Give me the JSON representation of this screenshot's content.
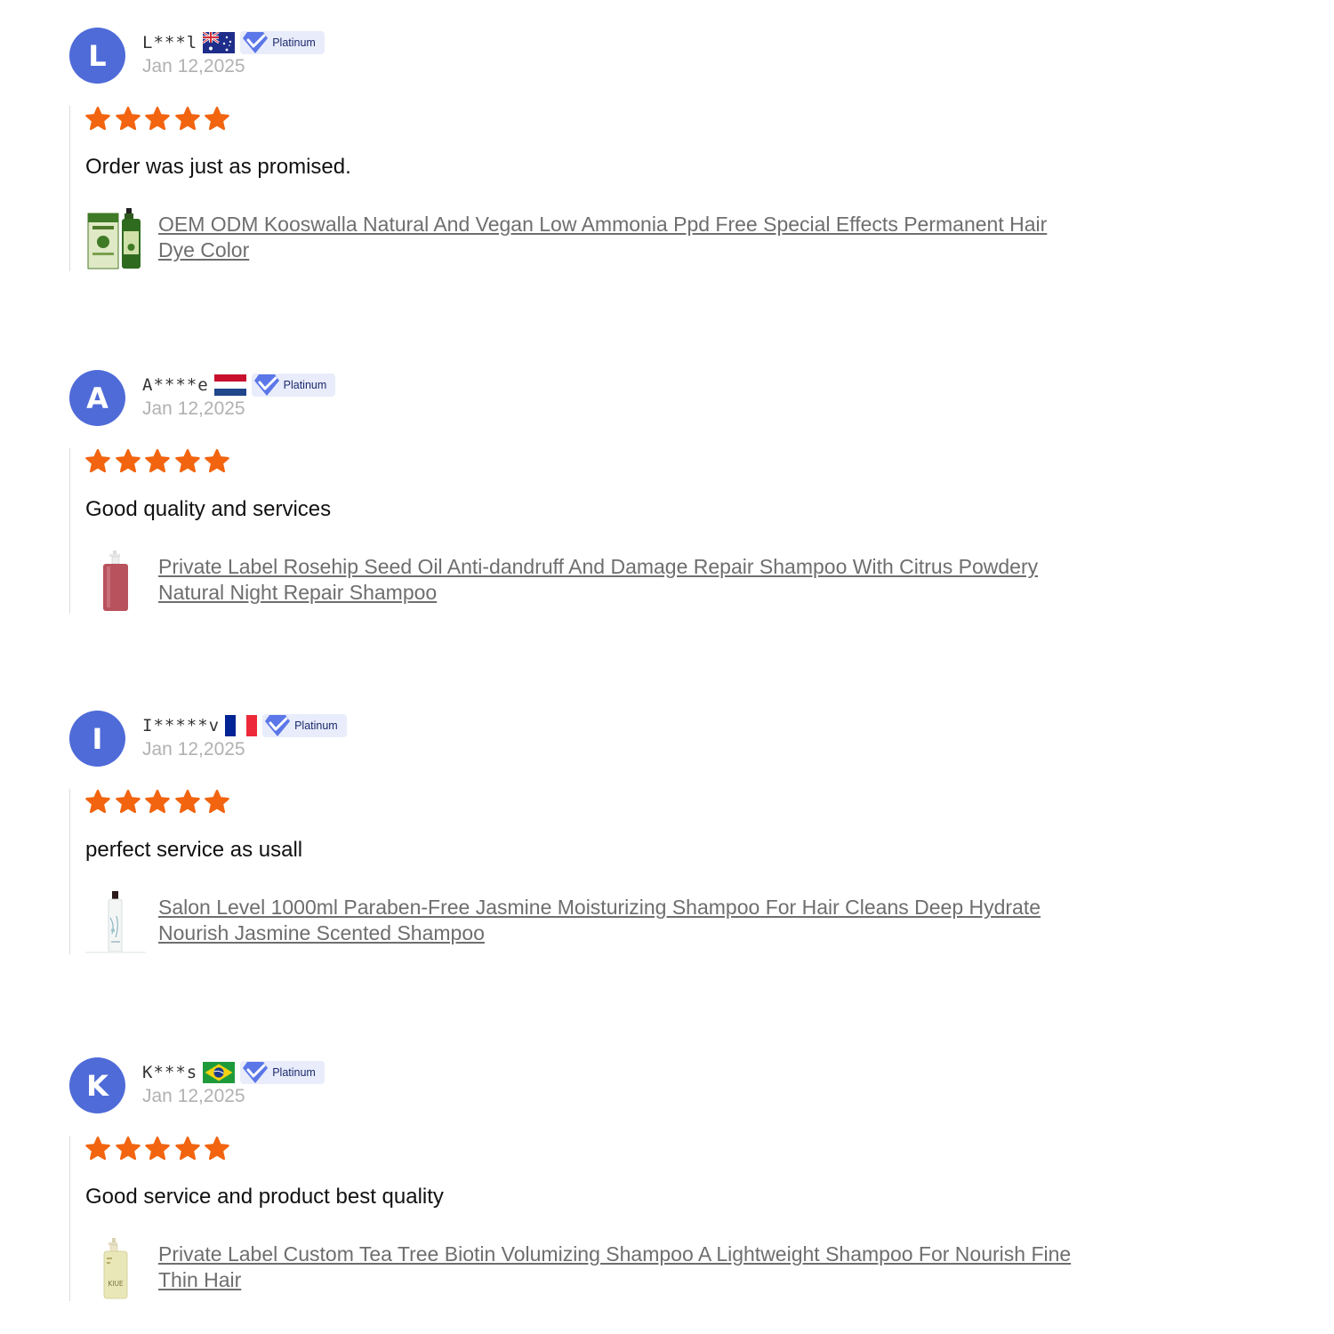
{
  "badge_label": "Platinum",
  "colors": {
    "avatar": "#4f6bd8",
    "star": "#f2640f",
    "date": "#b1b1b1",
    "link": "#6e6e6e"
  },
  "reviews": [
    {
      "avatar_letter": "L",
      "username": "L***l",
      "country_flag": "australia-flag",
      "date": "Jan 12,2025",
      "rating": 5,
      "comment": "Order was just as promised.",
      "product_title": "OEM ODM Kooswalla Natural And Vegan Low Ammonia Ppd Free Special Effects Permanent Hair Dye Color",
      "product_thumbnail": "green-box-and-bottle-thumbnail"
    },
    {
      "avatar_letter": "A",
      "username": "A****e",
      "country_flag": "netherlands-flag",
      "date": "Jan 12,2025",
      "rating": 5,
      "comment": "Good quality and services",
      "product_title": "Private Label Rosehip Seed Oil Anti-dandruff And Damage Repair Shampoo With Citrus Powdery Natural Night Repair Shampoo",
      "product_thumbnail": "red-pump-bottle-thumbnail"
    },
    {
      "avatar_letter": "I",
      "username": "I*****v",
      "country_flag": "france-flag",
      "date": "Jan 12,2025",
      "rating": 5,
      "comment": "perfect service as usall",
      "product_title": "Salon Level 1000ml Paraben-Free Jasmine Moisturizing Shampoo For Hair Cleans Deep Hydrate Nourish Jasmine Scented Shampoo",
      "product_thumbnail": "white-bottle-thumbnail"
    },
    {
      "avatar_letter": "K",
      "username": "K***s",
      "country_flag": "brazil-flag",
      "date": "Jan 12,2025",
      "rating": 5,
      "comment": "Good service and product best quality",
      "product_title": "Private Label Custom Tea Tree Biotin Volumizing Shampoo A Lightweight Shampoo For Nourish Fine Thin Hair",
      "product_thumbnail": "yellow-pump-bottle-thumbnail",
      "product_thumbnail_text": "KIUE"
    }
  ]
}
